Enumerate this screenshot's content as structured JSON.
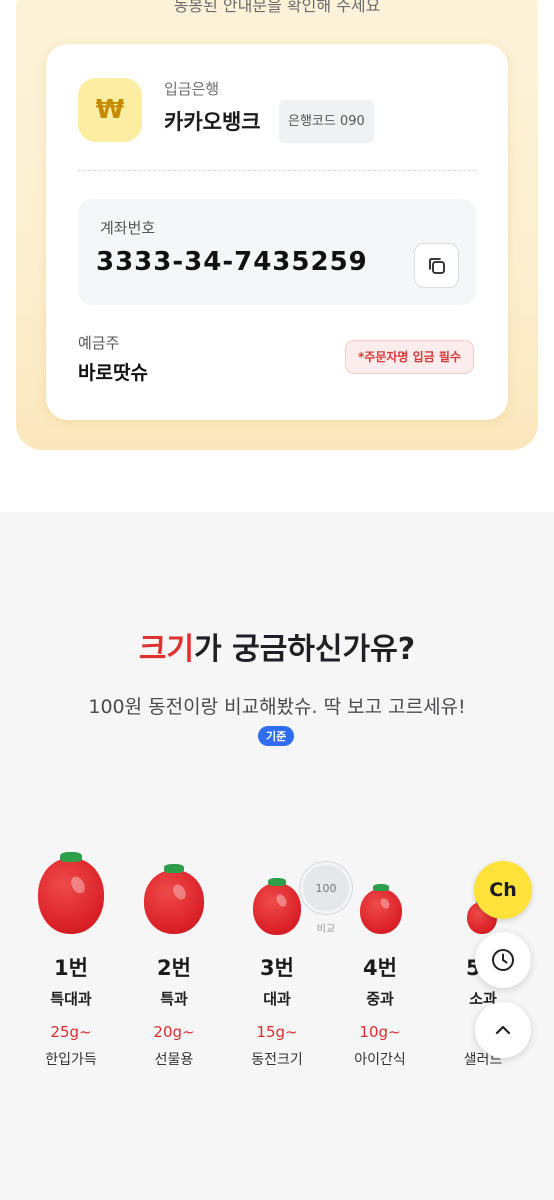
{
  "top_cut_text": "동봉된 안내문을 확인해 주세요",
  "account": {
    "currency_symbol": "₩",
    "bank_label": "입금은행",
    "bank_name": "카카오뱅크",
    "bank_code": "은행코드 090",
    "account_label": "계좌번호",
    "account_number": "3333-34-7435259",
    "owner_label": "예금주",
    "owner_name": "바로땃슈",
    "required_badge": "*주문자명 입금 필수",
    "icons": {
      "currency": "won-icon",
      "copy": "copy-icon"
    }
  },
  "size_section": {
    "title_highlight": "크기",
    "title_rest": "가 궁금하신가유?",
    "subtitle": "100원 동전이랑 비교해봤슈. 딱 보고 고르세유!",
    "reference_pill": "기준",
    "coin_value": "100",
    "coin_label": "비교",
    "grades": [
      {
        "num": "1번",
        "grade": "특대과",
        "weight": "25g~",
        "use": "한입가득"
      },
      {
        "num": "2번",
        "grade": "특과",
        "weight": "20g~",
        "use": "선물용"
      },
      {
        "num": "3번",
        "grade": "대과",
        "weight": "15g~",
        "use": "동전크기"
      },
      {
        "num": "4번",
        "grade": "중과",
        "weight": "10g~",
        "use": "아이간식"
      },
      {
        "num": "5번",
        "grade": "소과",
        "weight": "~",
        "use": "샐러드"
      }
    ]
  },
  "floating": {
    "channel_label": "Ch",
    "history_icon": "clock-icon",
    "top_icon": "chevron-up-icon"
  },
  "colors": {
    "accent_red": "#e03131",
    "pill_blue": "#2f6ef2",
    "channel_yellow": "#ffe23a",
    "card_gold": "#fcefd0"
  }
}
